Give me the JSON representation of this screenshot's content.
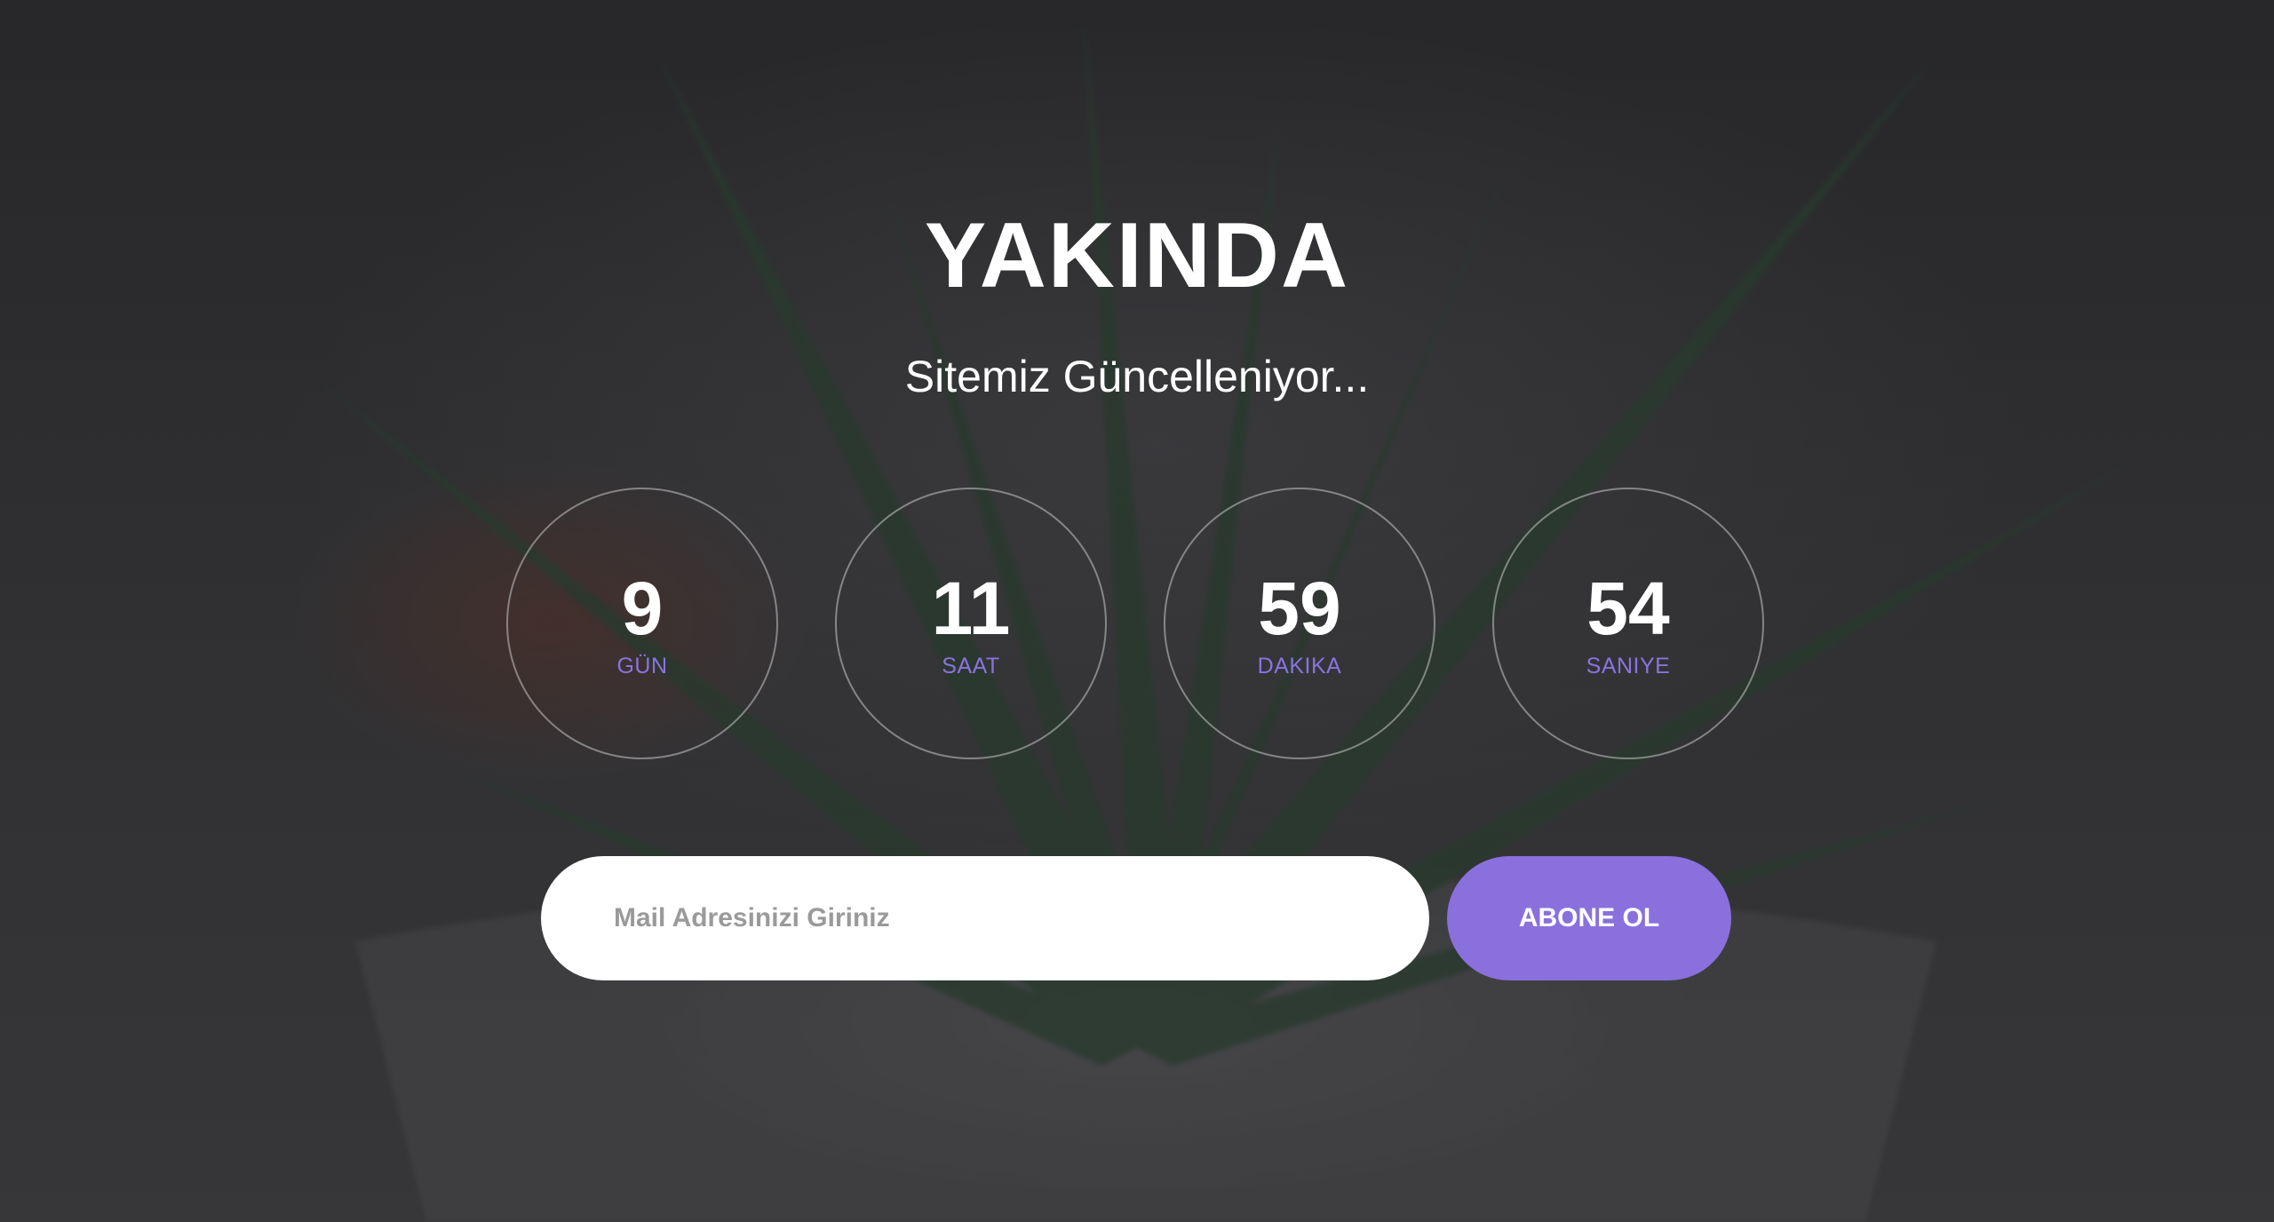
{
  "hero": {
    "title": "YAKINDA",
    "subtitle": "Sitemiz Güncelleniyor..."
  },
  "countdown": {
    "items": [
      {
        "value": "9",
        "label": "GÜN"
      },
      {
        "value": "11",
        "label": "SAAT"
      },
      {
        "value": "59",
        "label": "DAKIKA"
      },
      {
        "value": "54",
        "label": "SANIYE"
      }
    ]
  },
  "subscribe": {
    "email_placeholder": "Mail Adresinizi Giriniz",
    "email_value": "",
    "button_label": "ABONE OL"
  },
  "colors": {
    "accent": "#8a70dd",
    "title": "#ffffff",
    "overlay": "#2e2e30"
  }
}
